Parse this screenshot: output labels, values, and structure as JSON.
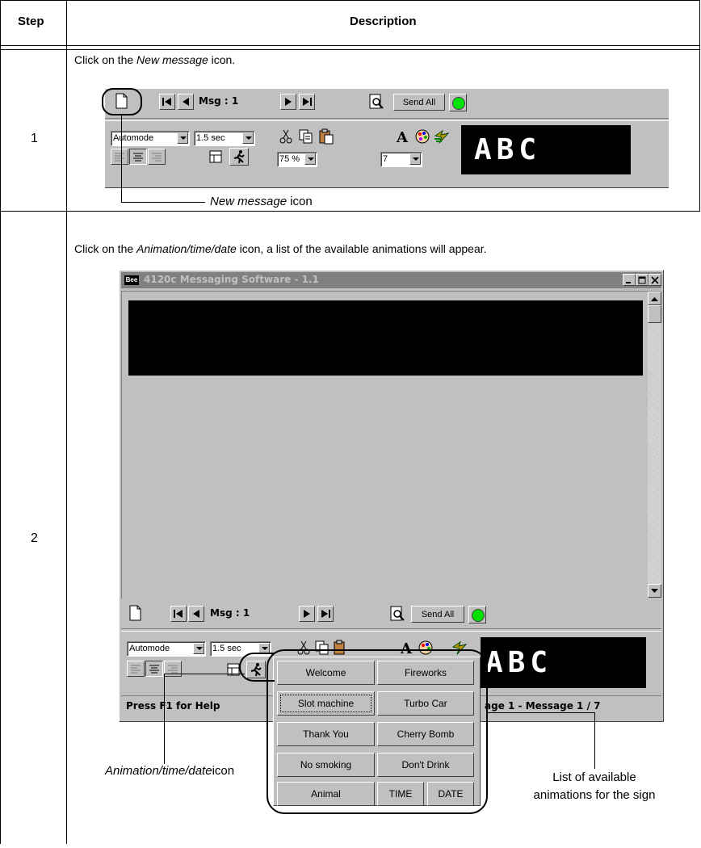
{
  "table": {
    "header_step": "Step",
    "header_description": "Description"
  },
  "step1": {
    "number": "1",
    "instruction_prefix": "Click on the ",
    "instruction_em": "New message",
    "instruction_suffix": " icon.",
    "caption_em": "New message",
    "caption_suffix": " icon"
  },
  "step2": {
    "number": "2",
    "instruction_prefix": "Click on the ",
    "instruction_em": "Animation/time/date",
    "instruction_suffix": " icon, a list of the available animations will appear.",
    "caption_em": "Animation/time/date",
    "caption_suffix": "icon",
    "list_caption_line1": "List of available",
    "list_caption_line2": "animations for the sign"
  },
  "toolbar": {
    "msg_label": "Msg : 1",
    "send_all": "Send All",
    "mode": "Automode",
    "duration": "1.5 sec",
    "zoom": "75 %",
    "font_size": "7",
    "preview_text": "ABC"
  },
  "window": {
    "title_badge": "Bee",
    "title": "4120c  Messaging Software - 1.1",
    "status_help": "Press F1 for Help",
    "status_page": "age 1  - Message 1  / 7"
  },
  "animations": [
    {
      "label": "Welcome"
    },
    {
      "label": "Fireworks"
    },
    {
      "label": "Slot machine"
    },
    {
      "label": "Turbo Car"
    },
    {
      "label": "Thank You"
    },
    {
      "label": "Cherry Bomb"
    },
    {
      "label": "No smoking"
    },
    {
      "label": "Don't Drink"
    },
    {
      "label": "Animal"
    },
    {
      "label": "TIME"
    },
    {
      "label": "DATE"
    }
  ]
}
